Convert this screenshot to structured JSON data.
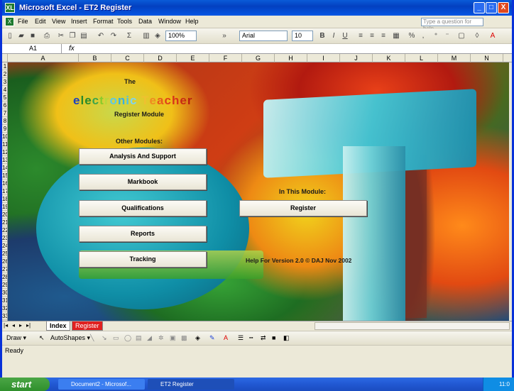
{
  "window": {
    "app_icon": "XL",
    "title": "Microsoft Excel - ET2 Register",
    "min": "_",
    "max": "□",
    "close": "X"
  },
  "menu": {
    "items": [
      "File",
      "Edit",
      "View",
      "Insert",
      "Format",
      "Tools",
      "Data",
      "Window",
      "Help"
    ],
    "help_placeholder": "Type a question for help"
  },
  "toolbar": {
    "zoom": "100%",
    "font": "Arial",
    "size": "10"
  },
  "formula": {
    "cell_ref": "A1",
    "fx": "fx"
  },
  "columns": [
    "A",
    "B",
    "C",
    "D",
    "E",
    "F",
    "G",
    "H",
    "I",
    "J",
    "K",
    "L",
    "M",
    "N"
  ],
  "rows": [
    "1",
    "2",
    "3",
    "4",
    "5",
    "6",
    "7",
    "8",
    "9",
    "10",
    "11",
    "12",
    "13",
    "14",
    "15",
    "16",
    "17",
    "18",
    "19",
    "20",
    "21",
    "22",
    "23",
    "24",
    "25",
    "26",
    "27",
    "28",
    "29",
    "30",
    "31",
    "32",
    "33"
  ],
  "content": {
    "the": "The",
    "title_letters": [
      {
        "ch": "e",
        "color": "#1a3fbf"
      },
      {
        "ch": "l",
        "color": "#2a8a2a"
      },
      {
        "ch": "e",
        "color": "#2a8a2a"
      },
      {
        "ch": "c",
        "color": "#3da54a"
      },
      {
        "ch": "t",
        "color": "#8acb2a"
      },
      {
        "ch": "r",
        "color": "#b8d83a"
      },
      {
        "ch": "o",
        "color": "#5cc8e8"
      },
      {
        "ch": "n",
        "color": "#3ab0e0"
      },
      {
        "ch": "i",
        "color": "#4cc0e6"
      },
      {
        "ch": "c",
        "color": "#7fd3ee"
      },
      {
        "ch": " ",
        "color": "#000"
      },
      {
        "ch": "T",
        "color": "#f0c030"
      },
      {
        "ch": "e",
        "color": "#f08a20"
      },
      {
        "ch": "a",
        "color": "#e85a1a"
      },
      {
        "ch": "c",
        "color": "#e0401a"
      },
      {
        "ch": "h",
        "color": "#d8341a"
      },
      {
        "ch": "e",
        "color": "#c82a14"
      },
      {
        "ch": "r",
        "color": "#b81e10"
      }
    ],
    "subtitle": "Register Module",
    "other_modules": "Other Modules:",
    "in_this_module": "In This Module:",
    "help_note": "Help For Version 2.0 © DAJ Nov 2002"
  },
  "buttons": {
    "analysis": "Analysis And Support",
    "markbook": "Markbook",
    "qualifications": "Qualifications",
    "reports": "Reports",
    "tracking": "Tracking",
    "register": "Register"
  },
  "tabs": {
    "index": "Index",
    "register": "Register"
  },
  "drawbar": {
    "draw": "Draw ▾",
    "autoshapes": "AutoShapes ▾"
  },
  "status": "Ready",
  "taskbar": {
    "start": "start",
    "task1": "Document2 - Microsof...",
    "task2": "ET2 Register",
    "clock": "11:0"
  }
}
